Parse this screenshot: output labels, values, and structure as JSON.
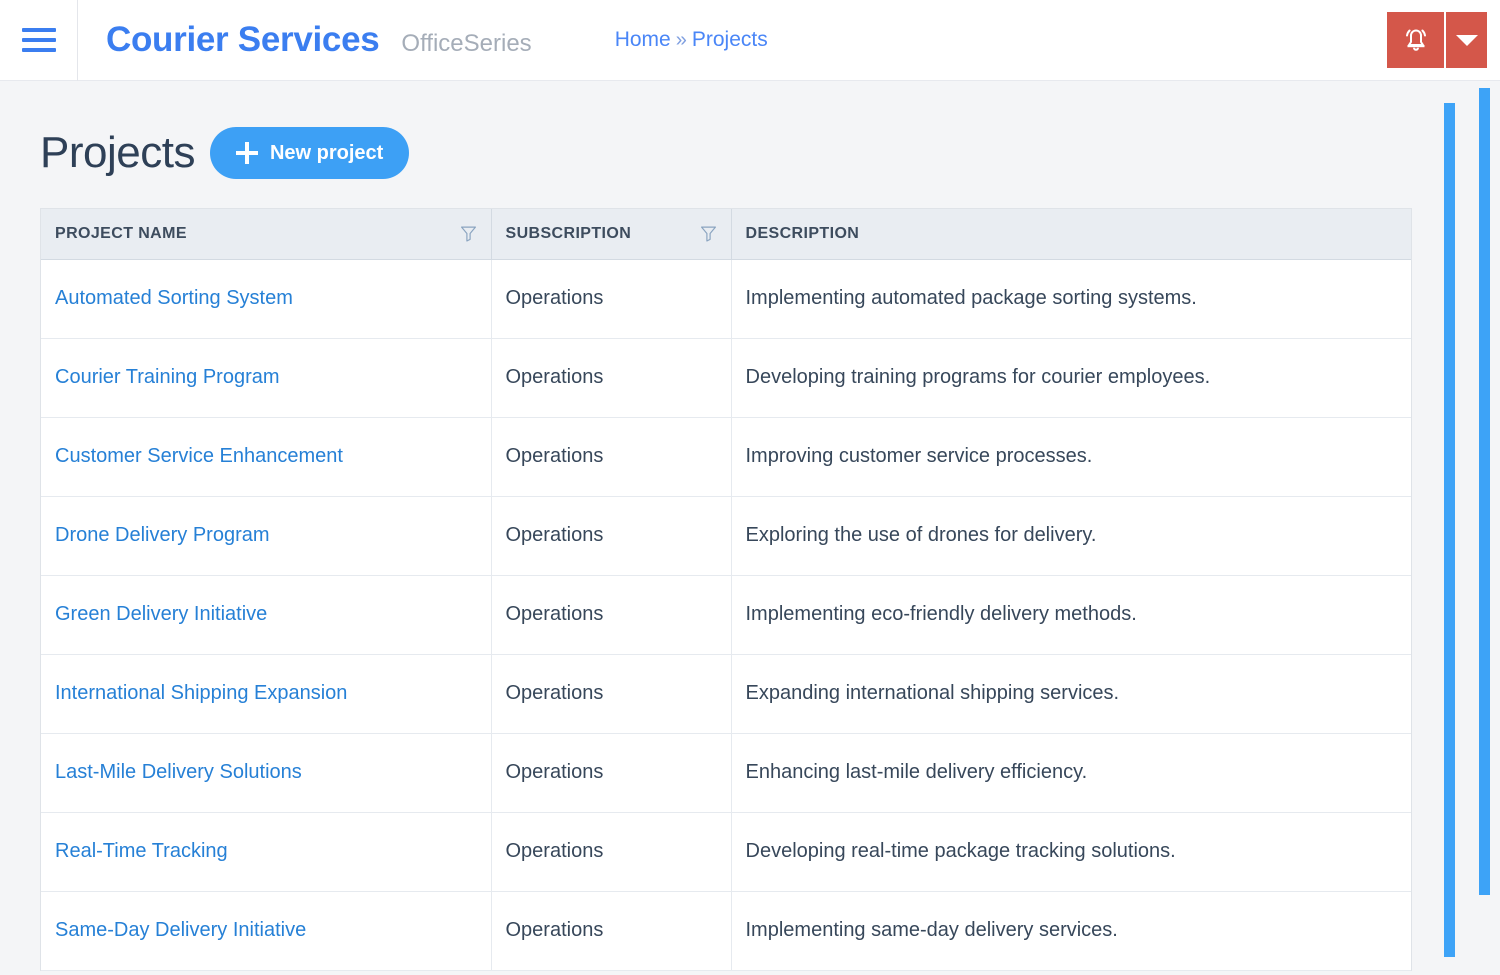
{
  "header": {
    "menu_icon": "hamburger-icon",
    "brand": "Courier Services",
    "brand_suffix": "OfficeSeries",
    "breadcrumb": {
      "home": "Home",
      "separator": "»",
      "current": "Projects"
    },
    "actions": {
      "notification_icon": "bell-icon",
      "caret_icon": "chevron-down-icon",
      "accent_color": "#d4574a"
    }
  },
  "main": {
    "title": "Projects",
    "new_project_label": "New project",
    "new_project_icon": "plus-icon",
    "accent_color": "#3da0f5",
    "table": {
      "columns": [
        {
          "label": "PROJECT NAME",
          "filter_icon": "filter-funnel-icon",
          "filterable": true
        },
        {
          "label": "SUBSCRIPTION",
          "filter_icon": "filter-funnel-icon",
          "filterable": true
        },
        {
          "label": "DESCRIPTION",
          "filter_icon": null,
          "filterable": false
        }
      ],
      "rows": [
        {
          "name": "Automated Sorting System",
          "subscription": "Operations",
          "description": "Implementing automated package sorting systems."
        },
        {
          "name": "Courier Training Program",
          "subscription": "Operations",
          "description": "Developing training programs for courier employees."
        },
        {
          "name": "Customer Service Enhancement",
          "subscription": "Operations",
          "description": "Improving customer service processes."
        },
        {
          "name": "Drone Delivery Program",
          "subscription": "Operations",
          "description": "Exploring the use of drones for delivery."
        },
        {
          "name": "Green Delivery Initiative",
          "subscription": "Operations",
          "description": "Implementing eco-friendly delivery methods."
        },
        {
          "name": "International Shipping Expansion",
          "subscription": "Operations",
          "description": "Expanding international shipping services."
        },
        {
          "name": "Last-Mile Delivery Solutions",
          "subscription": "Operations",
          "description": "Enhancing last-mile delivery efficiency."
        },
        {
          "name": "Real-Time Tracking",
          "subscription": "Operations",
          "description": "Developing real-time package tracking solutions."
        },
        {
          "name": "Same-Day Delivery Initiative",
          "subscription": "Operations",
          "description": "Implementing same-day delivery services."
        }
      ]
    }
  },
  "scrollbars": {
    "inner_color": "#3da3f7",
    "outer_color": "#3da3f7"
  }
}
